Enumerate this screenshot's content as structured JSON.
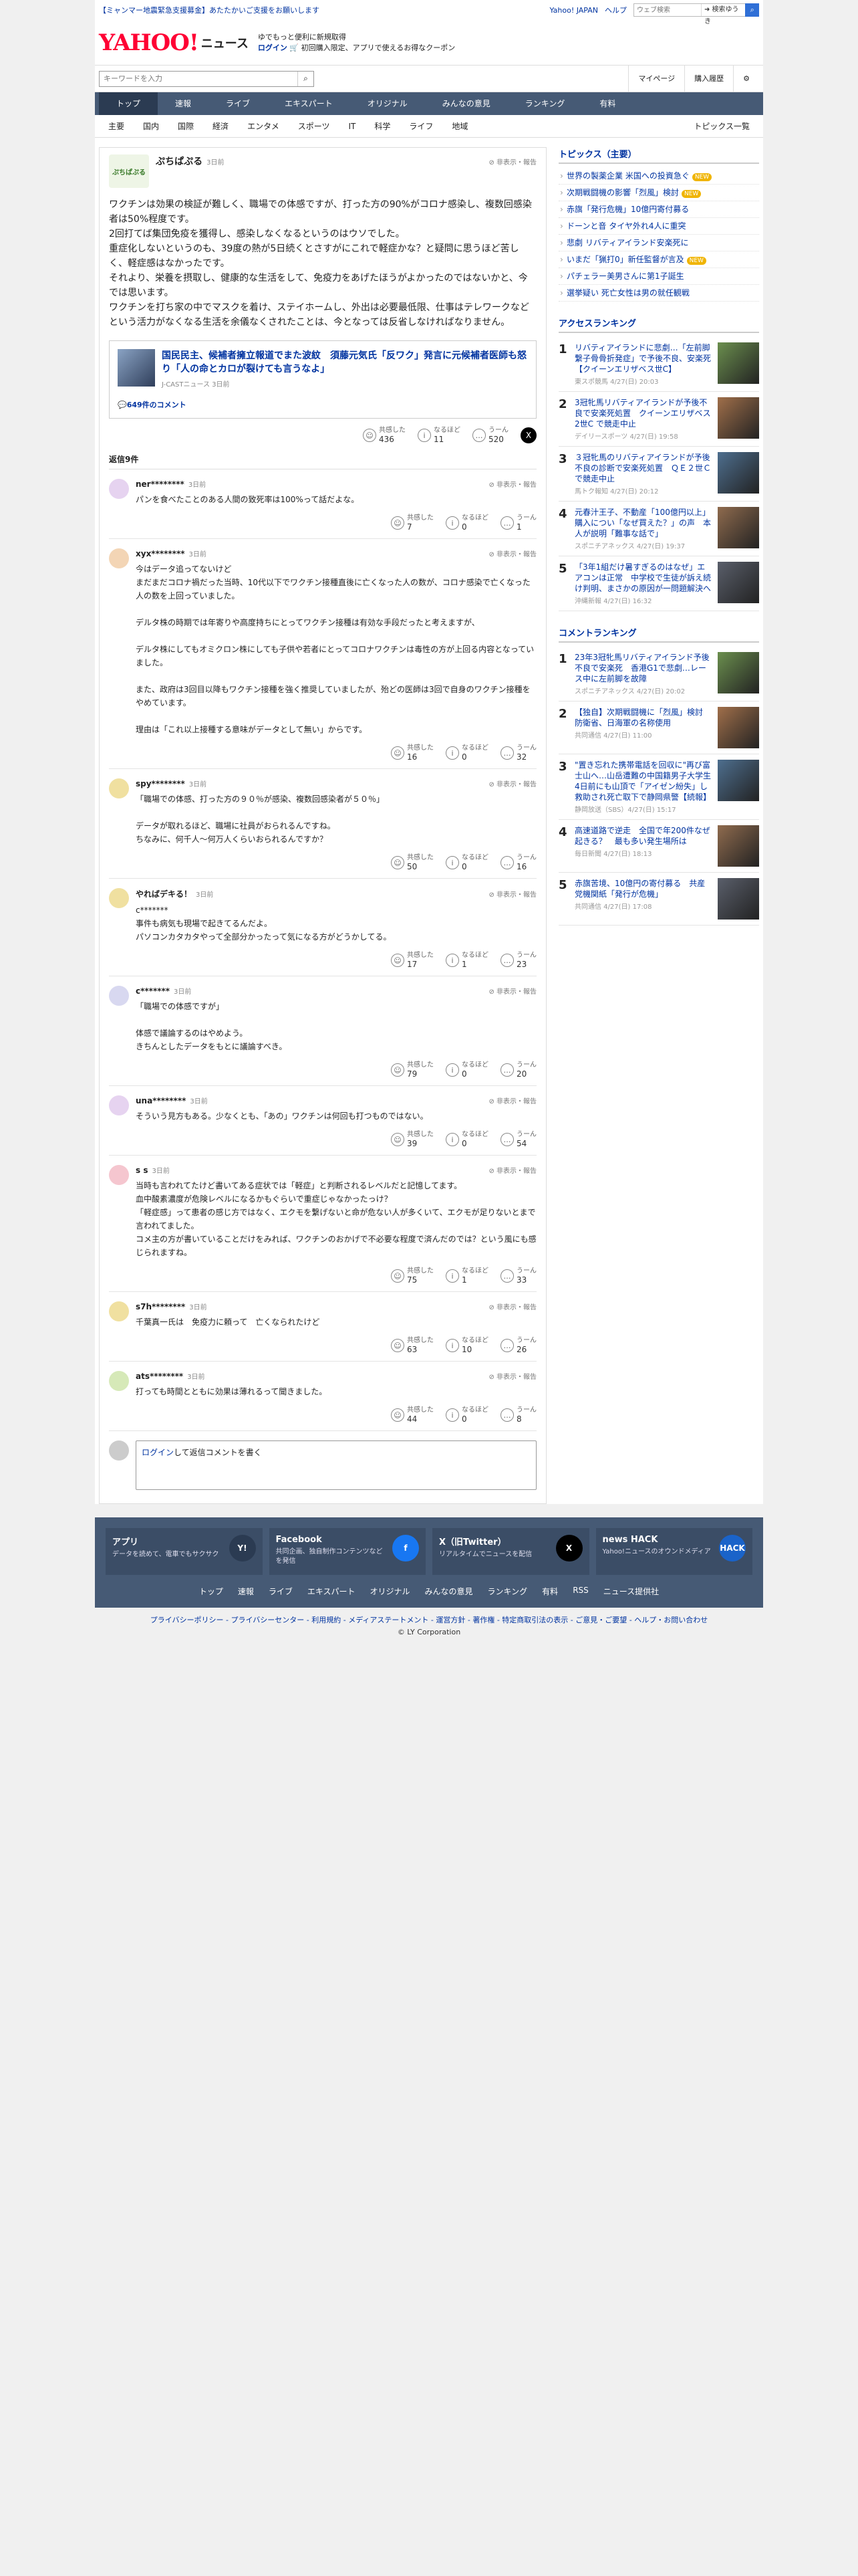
{
  "top": {
    "notice": "【ミャンマー地震緊急支援募金】あたたかいご支援をお願いします",
    "links": [
      "Yahoo! JAPAN",
      "ヘルプ"
    ],
    "search_placeholder": "ウェブ検索",
    "search_btn": "➜ 検索ゆうき"
  },
  "header": {
    "logo": "YAHOO!",
    "logo_sub": "ニュース",
    "promo1": "ゆでもっと便利に新規取得",
    "promo2": "ログイン",
    "promo3": "🛒 初回購入限定、アプリで使えるお得なクーポン"
  },
  "search": {
    "placeholder": "キーワードを入力",
    "mypage": "マイページ",
    "history": "購入履歴"
  },
  "gnav": [
    "トップ",
    "速報",
    "ライブ",
    "エキスパート",
    "オリジナル",
    "みんなの意見",
    "ランキング",
    "有料"
  ],
  "snav": [
    "主要",
    "国内",
    "国際",
    "経済",
    "エンタメ",
    "スポーツ",
    "IT",
    "科学",
    "ライフ",
    "地域"
  ],
  "snav_right": "トピックス一覧",
  "comment": {
    "avatar": "ぷちぱぷる",
    "user": "ぷちぱぷる",
    "ago": "3日前",
    "report": "非表示・報告",
    "text": "ワクチンは効果の検証が難しく、職場での体感ですが、打った方の90%がコロナ感染し、複数回感染者は50%程度です。\n2回打てば集団免疫を獲得し、感染しなくなるというのはウソでした。\n重症化しないというのも、39度の熱が5日続くとさすがにこれで軽症かな？と疑問に思うほど苦しく、軽症感はなかったです。\nそれより、栄養を摂取し、健康的な生活をして、免疫力をあげたほうがよかったのではないかと、今では思います。\nワクチンを打ち家の中でマスクを着け、ステイホームし、外出は必要最低限、仕事はテレワークなどという活力がなくなる生活を余儀なくされたことは、今となっては反省しなければなりません。",
    "article_title": "国民民主、候補者擁立報道でまた波紋　須藤元気氏「反ワク」発言に元候補者医師も怒り「人の命とカロが裂けても言うなよ」",
    "article_src": "J-CASTニュース 3日前",
    "article_count": "💬649件のコメント",
    "r1l": "共感した",
    "r1": "436",
    "r2l": "なるほど",
    "r2": "11",
    "r3l": "うーん",
    "r3": "520"
  },
  "reply_head": "返信9件",
  "replies": [
    {
      "name": "ner********",
      "ago": "3日前",
      "report": "非表示・報告",
      "text": "パンを食べたことのある人間の致死率は100%って話だよな。",
      "a": "7",
      "b": "0",
      "c": "1"
    },
    {
      "name": "xyx********",
      "ago": "3日前",
      "report": "非表示・報告",
      "text": "今はデータ追ってないけど\nまだまだコロナ禍だった当時、10代以下でワクチン接種直後に亡くなった人の数が、コロナ感染で亡くなった人の数を上回っていました。\n\nデルタ株の時期では年寄りや高度持ちにとってワクチン接種は有効な手段だったと考えますが、\n\nデルタ株にしてもオミクロン株にしても子供や若者にとってコロナワクチンは毒性の方が上回る内容となっていました。\n\nまた、政府は3回目以降もワクチン接種を強く推奨していましたが、殆どの医師は3回で自身のワクチン接種をやめています。\n\n理由は「これ以上接種する意味がデータとして無い」からです。",
      "a": "16",
      "b": "0",
      "c": "32"
    },
    {
      "name": "spy********",
      "ago": "3日前",
      "report": "非表示・報告",
      "text": "「職場での体感、打った方の９０％が感染、複数回感染者が５０％」\n\nデータが取れるほど、職場に社員がおられるんですね。\nちなみに、何千人〜何万人くらいおられるんですか？",
      "a": "50",
      "b": "0",
      "c": "16"
    },
    {
      "name": "やればデキる！",
      "ago": "3日前",
      "report": "非表示・報告",
      "text": "c*******\n事件も病気も現場で起きてるんだよ。\nパソコンカタカタやって全部分かったって気になる方がどうかしてる。",
      "a": "17",
      "b": "1",
      "c": "23"
    },
    {
      "name": "c*******",
      "ago": "3日前",
      "report": "非表示・報告",
      "text": "「職場での体感ですが」\n\n体感で議論するのはやめよう。\nきちんとしたデータをもとに議論すべき。",
      "a": "79",
      "b": "0",
      "c": "20"
    },
    {
      "name": "una********",
      "ago": "3日前",
      "report": "非表示・報告",
      "text": "そういう見方もある。少なくとも、「あの」ワクチンは何回も打つものではない。",
      "a": "39",
      "b": "0",
      "c": "54"
    },
    {
      "name": "s s",
      "ago": "3日前",
      "report": "非表示・報告",
      "text": "当時も言われてたけど書いてある症状では「軽症」と判断されるレベルだと記憶してます。\n血中酸素濃度が危険レベルになるかもぐらいで重症じゃなかったっけ？\n「軽症感」って患者の感じ方ではなく、エクモを繋げないと命が危ない人が多くいて、エクモが足りないとまで言われてました。\nコメ主の方が書いていることだけをみれば、ワクチンのおかげで不必要な程度で済んだのでは？という風にも感じられますね。",
      "a": "75",
      "b": "1",
      "c": "33"
    },
    {
      "name": "s7h********",
      "ago": "3日前",
      "report": "非表示・報告",
      "text": "千葉真一氏は　免疫力に頼って　亡くなられたけど",
      "a": "63",
      "b": "10",
      "c": "26"
    },
    {
      "name": "ats********",
      "ago": "3日前",
      "report": "非表示・報告",
      "text": "打っても時間とともに効果は薄れるって聞きました。",
      "a": "44",
      "b": "0",
      "c": "8"
    }
  ],
  "reply_form": {
    "login": "ログイン",
    "text": "して返信コメントを書く"
  },
  "react_labels": {
    "a": "共感した",
    "b": "なるほど",
    "c": "うーん"
  },
  "topics": {
    "title": "トピックス（主要）",
    "items": [
      "世界の製薬企業 米国への投資急ぐ",
      "次期戦闘機の影響「烈風」検討",
      "赤旗「発行危機」10億円寄付募る",
      "ドーンと音 タイヤ外れ4人に重突",
      "悲劇 リバティアイランド安楽死に",
      "いまだ「猟打0」新任監督が言及",
      "パチェラー美男さんに第1子誕生",
      "選挙疑い 死亡女性は男の就任観戦"
    ],
    "badges": [
      "NEW",
      "NEW",
      "",
      "",
      "",
      "NEW",
      "",
      ""
    ]
  },
  "access": {
    "title": "アクセスランキング",
    "items": [
      {
        "n": "1",
        "t": "リバティアイランドに悲劇…「左前脚繋子骨骨折発症」で予後不良、安楽死【クイーンエリザベス世C】",
        "s": "東スポ競馬 4/27(日) 20:03"
      },
      {
        "n": "2",
        "t": "3冠牝馬リバティアイランドが予後不良で安楽死処置　クイーンエリザベス2世C で競走中止",
        "s": "デイリースポーツ 4/27(日) 19:58"
      },
      {
        "n": "3",
        "t": "３冠牝馬のリバティアイランドが予後不良の診断で安楽死処置　ＱＥ２世Ｃで競走中止",
        "s": "馬トク報知 4/27(日) 20:12"
      },
      {
        "n": "4",
        "t": "元春汁王子、不動産「100億円以上」購入につい「なぜ買えた？」の声　本人が説明「難事な話で」",
        "s": "スポニチアネックス 4/27(日) 19:37"
      },
      {
        "n": "5",
        "t": "「3年1組だけ暑すぎるのはなぜ」エアコンは正常　中学校で生徒が訴え続け判明、まさかの原因が一問題解決へ",
        "s": "沖縄新報 4/27(日) 16:32"
      }
    ]
  },
  "comment_rank": {
    "title": "コメントランキング",
    "items": [
      {
        "n": "1",
        "t": "23年3冠牝馬リバティアイランド予後不良で安楽死　香港G1で悲劇…レース中に左前脚を故障",
        "s": "スポニチアネックス 4/27(日) 20:02"
      },
      {
        "n": "2",
        "t": "【独自】次期戦闘機に「烈風」検討　防衛省、日海軍の名称使用",
        "s": "共同通信 4/27(日) 11:00"
      },
      {
        "n": "3",
        "t": "\"置き忘れた携帯電話を回収に\"再び富士山へ…山岳遭難の中国籍男子大学生 4日前にも山頂で「アイゼン紛失」し救助され死亡取下で静岡県警【続報】",
        "s": "静岡放送（SBS）4/27(日) 15:17"
      },
      {
        "n": "4",
        "t": "高速道路で逆走　全国で年200件なぜ起きる？　最も多い発生場所は",
        "s": "毎日新聞 4/27(日) 18:13"
      },
      {
        "n": "5",
        "t": "赤旗苦境、10億円の寄付募る　共産党機関紙「発行が危機」",
        "s": "共同通信 4/27(日) 17:08"
      }
    ]
  },
  "footer": {
    "cols": [
      {
        "t": "アプリ",
        "d": "データを読めて、電車でもサクサク",
        "ic": "Y!",
        "bg": "#2b3b52"
      },
      {
        "t": "Facebook",
        "d": "共同企画、独自制作コンテンツなどを発信",
        "ic": "f",
        "bg": "#1877f2"
      },
      {
        "t": "X（旧Twitter）",
        "d": "リアルタイムでニュースを配信",
        "ic": "X",
        "bg": "#000000"
      },
      {
        "t": "news HACK",
        "d": "Yahoo!ニュースのオウンドメディア",
        "ic": "HACK",
        "bg": "#1a63c9"
      }
    ],
    "links": [
      "トップ",
      "速報",
      "ライブ",
      "エキスパート",
      "オリジナル",
      "みんなの意見",
      "ランキング",
      "有料",
      "RSS",
      "ニュース提供社"
    ]
  },
  "bottom": {
    "links": "プライバシーポリシー - プライバシーセンター - 利用規約 - メディアステートメント - 運営方針 - 著作権 - 特定商取引法の表示 - ご意見・ご要望 - ヘルプ・お問い合わせ",
    "copy": "© LY Corporation"
  }
}
